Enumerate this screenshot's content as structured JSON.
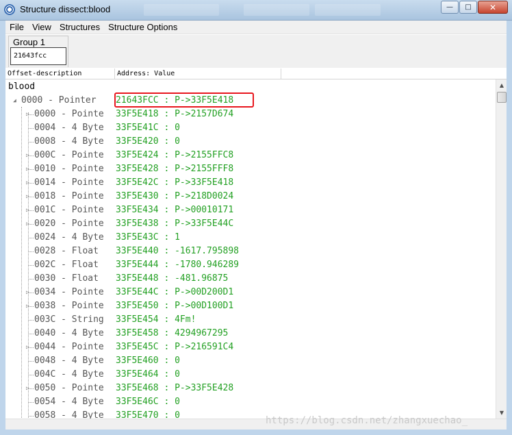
{
  "window": {
    "title": "Structure dissect:blood",
    "icon": "cheat-engine-icon",
    "controls": {
      "minimize": "—",
      "maximize": "□",
      "close": "✕"
    }
  },
  "menu": [
    "File",
    "View",
    "Structures",
    "Structure Options"
  ],
  "group": {
    "label": "Group 1",
    "address": "21643fcc"
  },
  "columns": {
    "offset": "Offset-description",
    "value": "Address: Value"
  },
  "tree": {
    "root": "blood",
    "node": {
      "desc": "0000 - Pointer",
      "value": "21643FCC : P->33F5E418"
    },
    "rows": [
      {
        "desc": "0000 - Pointe",
        "value": "33F5E418 : P->2157D674",
        "expandable": true
      },
      {
        "desc": "0004 - 4 Byte",
        "value": "33F5E41C : 0",
        "expandable": false
      },
      {
        "desc": "0008 - 4 Byte",
        "value": "33F5E420 : 0",
        "expandable": false
      },
      {
        "desc": "000C - Pointe",
        "value": "33F5E424 : P->2155FFC8",
        "expandable": true
      },
      {
        "desc": "0010 - Pointe",
        "value": "33F5E428 : P->2155FFF8",
        "expandable": true
      },
      {
        "desc": "0014 - Pointe",
        "value": "33F5E42C : P->33F5E418",
        "expandable": true
      },
      {
        "desc": "0018 - Pointe",
        "value": "33F5E430 : P->218D0024",
        "expandable": true
      },
      {
        "desc": "001C - Pointe",
        "value": "33F5E434 : P->00010171",
        "expandable": true
      },
      {
        "desc": "0020 - Pointe",
        "value": "33F5E438 : P->33F5E44C",
        "expandable": true
      },
      {
        "desc": "0024 - 4 Byte",
        "value": "33F5E43C : 1",
        "expandable": false
      },
      {
        "desc": "0028 - Float ",
        "value": "33F5E440 : -1617.795898",
        "expandable": false
      },
      {
        "desc": "002C - Float ",
        "value": "33F5E444 : -1780.946289",
        "expandable": false
      },
      {
        "desc": "0030 - Float ",
        "value": "33F5E448 : -481.96875",
        "expandable": false
      },
      {
        "desc": "0034 - Pointe",
        "value": "33F5E44C : P->00D200D1",
        "expandable": true
      },
      {
        "desc": "0038 - Pointe",
        "value": "33F5E450 : P->00D100D1",
        "expandable": true
      },
      {
        "desc": "003C - String",
        "value": "33F5E454 : 4Fm!",
        "expandable": false
      },
      {
        "desc": "0040 - 4 Byte",
        "value": "33F5E458 : 4294967295",
        "expandable": false
      },
      {
        "desc": "0044 - Pointe",
        "value": "33F5E45C : P->216591C4",
        "expandable": true
      },
      {
        "desc": "0048 - 4 Byte",
        "value": "33F5E460 : 0",
        "expandable": false
      },
      {
        "desc": "004C - 4 Byte",
        "value": "33F5E464 : 0",
        "expandable": false
      },
      {
        "desc": "0050 - Pointe",
        "value": "33F5E468 : P->33F5E428",
        "expandable": true
      },
      {
        "desc": "0054 - 4 Byte",
        "value": "33F5E46C : 0",
        "expandable": false
      },
      {
        "desc": "0058 - 4 Byte",
        "value": "33F5E470 : 0",
        "expandable": false
      }
    ]
  },
  "watermark": "https://blog.csdn.net/zhangxuechao_",
  "colors": {
    "value_text": "#22a022",
    "desc_text": "#555555",
    "highlight": "#e8161d"
  }
}
